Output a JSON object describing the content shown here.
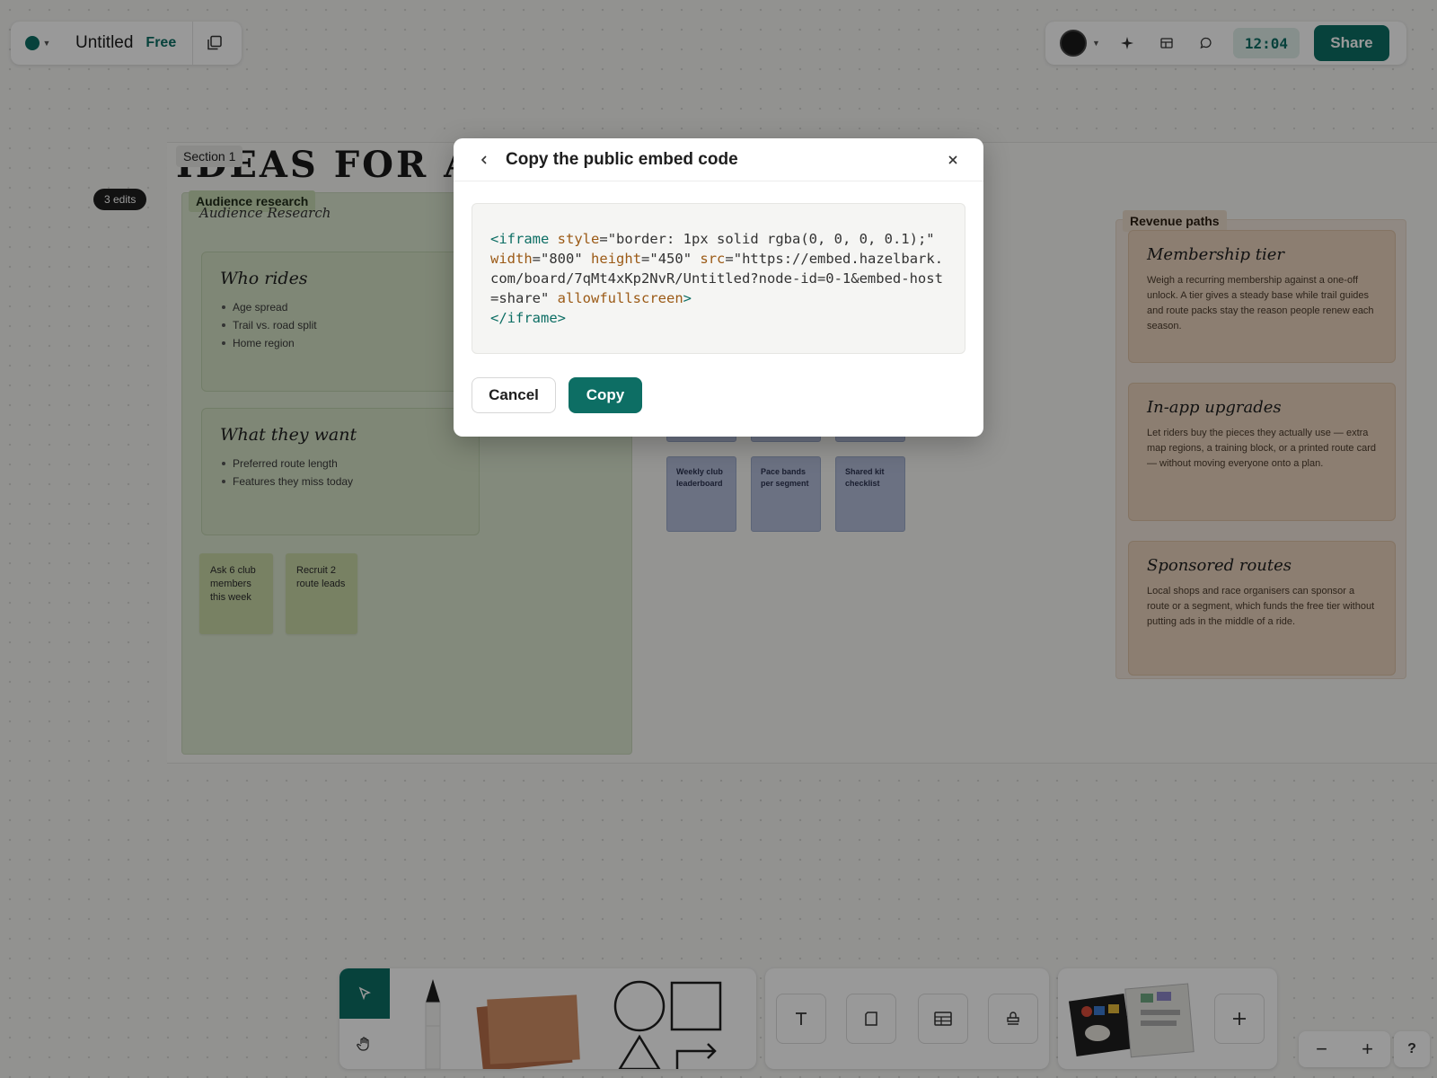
{
  "toolbar": {
    "board_title": "Untitled",
    "plan": "Free",
    "timer": "12:04",
    "share_label": "Share"
  },
  "canvas": {
    "section_label": "Section 1",
    "big_title": "IDEAS FOR A N",
    "edits_badge": "3 edits",
    "audience": {
      "tag": "Audience research",
      "subtitle": "Audience Research",
      "cards": [
        {
          "title": "Who rides",
          "items": [
            "Age spread",
            "Trail vs. road split",
            "Home region"
          ]
        },
        {
          "title": "What they want",
          "items": [
            "Preferred route length",
            "Features they miss today"
          ]
        }
      ],
      "stickies": [
        "Ask 6 club members this week",
        "Recruit 2 route leads"
      ]
    },
    "feature_stickies": [
      "Weekly club leaderboard",
      "Pace bands per segment",
      "Shared kit checklist"
    ],
    "revenue": {
      "tag": "Revenue paths",
      "cards": [
        {
          "title": "Membership tier",
          "body": "Weigh a recurring membership against a one-off unlock. A tier gives a steady base while trail guides and route packs stay the reason people renew each season."
        },
        {
          "title": "In-app upgrades",
          "body": "Let riders buy the pieces they actually use — extra map regions, a training block, or a printed route card — without moving everyone onto a plan."
        },
        {
          "title": "Sponsored routes",
          "body": "Local shops and race organisers can sponsor a route or a segment, which funds the free tier without putting ads in the middle of a ride."
        }
      ]
    }
  },
  "modal": {
    "title": "Copy the public embed code",
    "code": {
      "tag_open": "<iframe",
      "attr_style": "style",
      "val_style": "\"border: 1px solid rgba(0, 0, 0, 0.1);\"",
      "attr_width": "width",
      "val_width": "\"800\"",
      "attr_height": "height",
      "val_height": "\"450\"",
      "attr_src": "src",
      "val_src": "\"https://embed.hazelbark.com/board/7qMt4xKp2NvR/Untitled?node-id=0-1&embed-host=share\"",
      "attr_allow": "allowfullscreen",
      "tag_gt": ">",
      "tag_close": "</iframe>",
      "eq": "="
    },
    "cancel_label": "Cancel",
    "copy_label": "Copy"
  },
  "bottom": {
    "zoom_out": "−",
    "zoom_in": "+",
    "help": "?"
  },
  "colors": {
    "accent": "#0d6e64",
    "green_panel": "#dbe6cf",
    "revenue_panel": "#f0e5da",
    "blue_sticky": "#b2bdd9",
    "orange_sticky": "#c98a63"
  },
  "icons": [
    "logo-icon",
    "duplicate-icon",
    "sparkle-icon",
    "layout-icon",
    "comment-icon",
    "back-arrow-icon",
    "close-icon",
    "select-cursor-icon",
    "hand-icon",
    "pen-icon",
    "text-icon",
    "frame-icon",
    "table-icon",
    "stamp-icon",
    "plus-icon"
  ]
}
